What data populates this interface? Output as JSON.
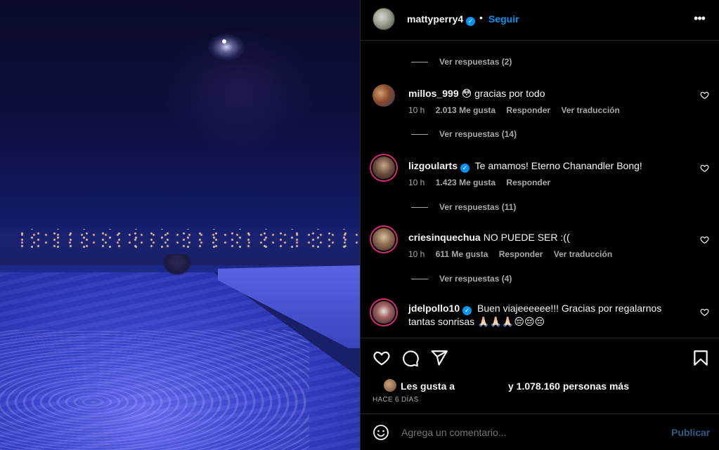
{
  "post": {
    "username": "mattyperry4",
    "follow_label": "Seguir",
    "separator": "•"
  },
  "comments": [
    {
      "type": "replies",
      "label": "Ver respuestas (2)"
    },
    {
      "type": "comment",
      "user": "millos_999",
      "text": "😳 gracias por todo",
      "time": "10 h",
      "likes": "2.013 Me gusta",
      "reply": "Responder",
      "translate": "Ver traducción"
    },
    {
      "type": "replies",
      "label": "Ver respuestas (14)"
    },
    {
      "type": "comment",
      "user": "lizgoularts",
      "verified": true,
      "text": "Te amamos! Eterno Chanandler Bong!",
      "time": "10 h",
      "likes": "1.423 Me gusta",
      "reply": "Responder"
    },
    {
      "type": "replies",
      "label": "Ver respuestas (11)"
    },
    {
      "type": "comment",
      "user": "criesinquechua",
      "text": "NO PUEDE SER :((",
      "time": "10 h",
      "likes": "611 Me gusta",
      "reply": "Responder",
      "translate": "Ver traducción"
    },
    {
      "type": "replies",
      "label": "Ver respuestas (4)"
    },
    {
      "type": "comment",
      "user": "jdelpollo10",
      "verified": true,
      "text": "Buen viajeeeeee!!! Gracias por regalarnos tantas sonrisas 🙏🏻🙏🏻🙏🏻😔😔😔"
    }
  ],
  "likes": {
    "prefix": "Les gusta a",
    "suffix": "y 1.078.160 personas más"
  },
  "timestamp": "HACE 6 DÍAS",
  "add_comment": {
    "placeholder": "Agrega un comentario...",
    "publish_label": "Publicar"
  },
  "icons": [
    "heart-icon",
    "comment-icon",
    "share-icon",
    "bookmark-icon",
    "more-icon",
    "emoji-icon",
    "verified-icon"
  ],
  "colors": {
    "background": "#000000",
    "text": "#f5f5f5",
    "secondary_text": "#a8a8a8",
    "accent": "#0095f6",
    "publish_disabled": "#2b5d87",
    "divider": "#262626",
    "story_ring": "#d62976"
  }
}
